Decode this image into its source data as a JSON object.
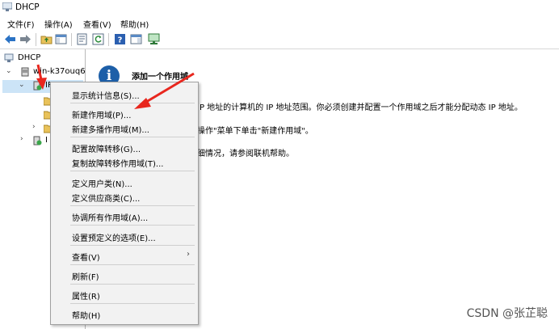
{
  "window": {
    "title": "DHCP"
  },
  "menubar": {
    "items": [
      "文件(F)",
      "操作(A)",
      "查看(V)",
      "帮助(H)"
    ]
  },
  "toolbar": {
    "icons": [
      "back-arrow-icon",
      "forward-arrow-icon",
      "folder-icon",
      "properties-icon",
      "list-icon",
      "refresh-icon",
      "help-icon",
      "panel-icon",
      "monitor-icon"
    ]
  },
  "tree": {
    "root": "DHCP",
    "server": "win-k37ouq6",
    "ipv4_label": "IP",
    "ipv6_label": "I"
  },
  "pane": {
    "title": "添加一个作用域",
    "line1": "IP 地址的计算机的 IP 地址范围。你必须创建并配置一个作用域之后才能分配动态 IP 地址。",
    "line2": "操作\"菜单下单击\"新建作用域\"。",
    "line3": "细情况，请参阅联机帮助。"
  },
  "context_menu": {
    "items": [
      "显示统计信息(S)...",
      "新建作用域(P)...",
      "新建多播作用域(M)...",
      "配置故障转移(G)...",
      "复制故障转移作用域(T)...",
      "定义用户类(N)...",
      "定义供应商类(C)...",
      "协调所有作用域(A)...",
      "设置预定义的选项(E)...",
      "查看(V)",
      "刷新(F)",
      "属性(R)",
      "帮助(H)"
    ]
  },
  "watermark": "CSDN @张芷聪",
  "colors": {
    "annotation": "#e8271e",
    "info": "#1d5fa8"
  }
}
